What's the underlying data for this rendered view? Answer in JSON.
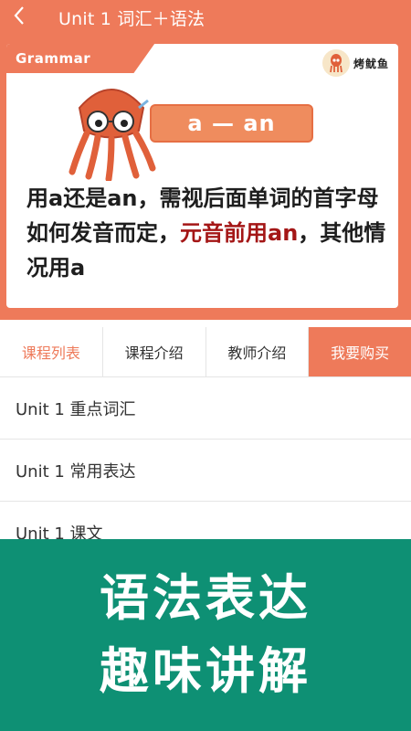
{
  "header": {
    "title": "Unit 1 词汇＋语法",
    "back_icon": "chevron-left-icon"
  },
  "banner": {
    "tag": "Grammar",
    "brand_name": "烤鱿鱼",
    "pill": "a — an",
    "rule_part1": "用a还是an，需视后面单词的首字母如何发音而定，",
    "rule_highlight": "元音前用an",
    "rule_part2": "，其他情况用a",
    "highlight_color": "#a41616"
  },
  "tabs": [
    {
      "label": "课程列表",
      "active": true
    },
    {
      "label": "课程介绍",
      "active": false
    },
    {
      "label": "教师介绍",
      "active": false
    },
    {
      "label": "我要购买",
      "active": false
    }
  ],
  "lessons": [
    {
      "label": "Unit 1 重点词汇"
    },
    {
      "label": "Unit 1 常用表达"
    },
    {
      "label": "Unit 1 课文"
    }
  ],
  "promo": {
    "line1": "语法表达",
    "line2": "趣味讲解"
  },
  "colors": {
    "accent": "#ee7a5a",
    "promo_bg": "#0e9074"
  }
}
